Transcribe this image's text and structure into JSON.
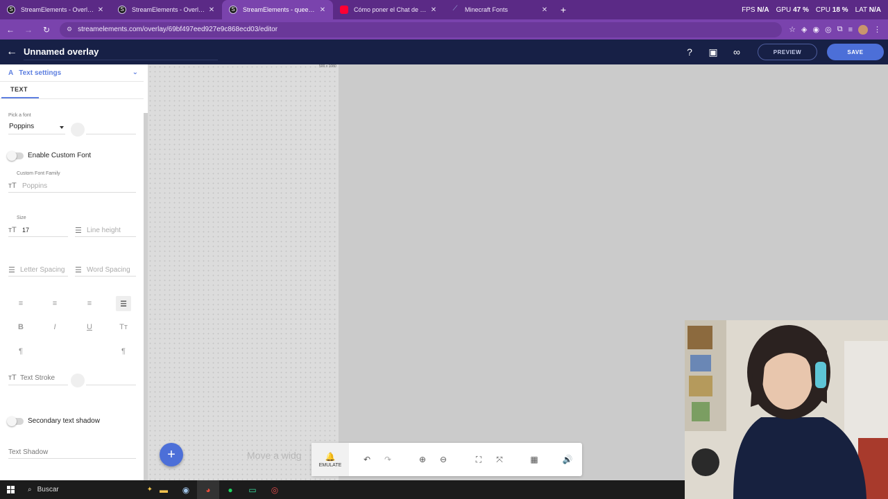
{
  "browser": {
    "tabs": [
      {
        "title": "StreamElements - Overlays",
        "icon": "streamelements",
        "active": false
      },
      {
        "title": "StreamElements - Overlays",
        "icon": "streamelements",
        "active": false
      },
      {
        "title": "StreamElements - queenrochi",
        "icon": "streamelements",
        "active": true
      },
      {
        "title": "Cómo poner el Chat de Twitch",
        "icon": "youtube",
        "active": false
      },
      {
        "title": "Minecraft Fonts",
        "icon": "minecraft-fonts",
        "active": false
      }
    ],
    "new_tab": "+",
    "system": {
      "fps_label": "FPS",
      "fps_value": "N/A",
      "gpu_label": "GPU",
      "gpu_value": "47 %",
      "cpu_label": "CPU",
      "cpu_value": "18 %",
      "lat_label": "LAT",
      "lat_value": "N/A"
    },
    "url": "streamelements.com/overlay/69bf497eed927e9c868ecd03/editor"
  },
  "header": {
    "title": "Unnamed overlay",
    "preview_label": "PREVIEW",
    "save_label": "SAVE"
  },
  "panel": {
    "section_title": "Text settings",
    "tab_label": "TEXT",
    "font_label": "Pick a font",
    "font_value": "Poppins",
    "custom_font_toggle_label": "Enable Custom Font",
    "custom_font_family_label": "Custom Font Family",
    "custom_font_family_placeholder": "Poppins",
    "size_label": "Size",
    "size_value": "17",
    "line_height_placeholder": "Line height",
    "letter_spacing_placeholder": "Letter Spacing",
    "word_spacing_placeholder": "Word Spacing",
    "format_buttons": [
      "B",
      "I",
      "U",
      "Tт"
    ],
    "text_stroke_label": "Text Stroke",
    "secondary_shadow_label": "Secondary text shadow",
    "text_shadow_label": "Text Shadow"
  },
  "canvas": {
    "size_label": "500 x 1080",
    "hint_text": "Move a widg",
    "emulate_label": "EMULATE"
  },
  "taskbar": {
    "search_label": "Buscar"
  }
}
